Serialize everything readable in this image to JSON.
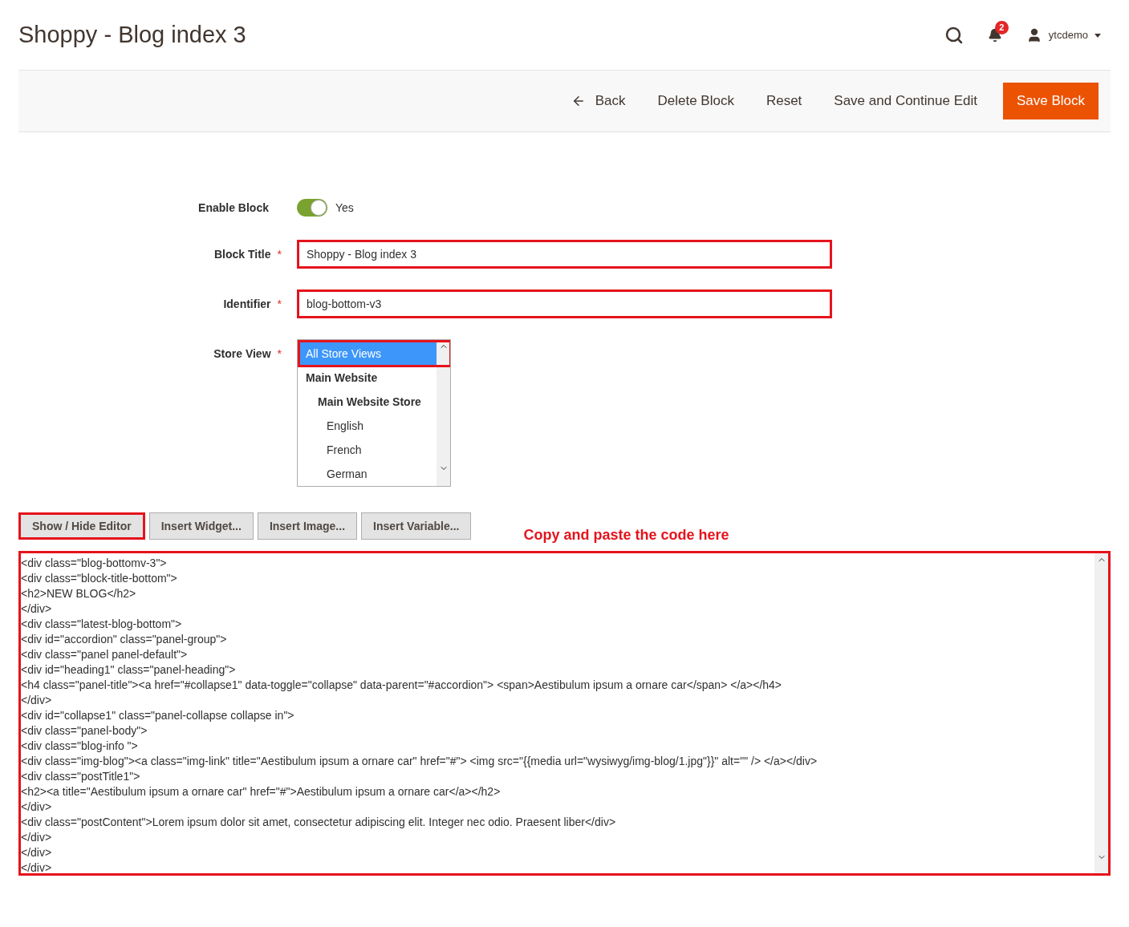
{
  "header": {
    "title": "Shoppy - Blog index 3",
    "notifications": "2",
    "user": "ytcdemo"
  },
  "actions": [
    {
      "label": "Back",
      "kind": "back"
    },
    {
      "label": "Delete Block",
      "kind": "plain"
    },
    {
      "label": "Reset",
      "kind": "plain"
    },
    {
      "label": "Save and Continue Edit",
      "kind": "plain"
    },
    {
      "label": "Save Block",
      "kind": "primary"
    }
  ],
  "form": {
    "enable": {
      "label": "Enable Block",
      "on": true,
      "value": "Yes"
    },
    "title": {
      "label": "Block Title",
      "required": "*",
      "value": "Shoppy - Blog index 3"
    },
    "identifier": {
      "label": "Identifier",
      "required": "*",
      "value": "blog-bottom-v3"
    },
    "store_view": {
      "label": "Store View",
      "required": "*",
      "options": [
        {
          "label": "All Store Views",
          "kind": "option",
          "selected": true
        },
        {
          "label": "Main Website",
          "kind": "group",
          "selected": false,
          "children": [
            {
              "label": "Main Website Store",
              "kind": "group",
              "selected": false,
              "children": [
                {
                  "label": "English",
                  "kind": "option",
                  "selected": false
                },
                {
                  "label": "French",
                  "kind": "option",
                  "selected": false
                },
                {
                  "label": "German",
                  "kind": "option",
                  "selected": false
                }
              ]
            }
          ]
        }
      ]
    }
  },
  "editor_buttons": [
    "Show / Hide Editor",
    "Insert Widget...",
    "Insert Image...",
    "Insert Variable..."
  ],
  "note": "Copy and paste the code here",
  "code_lines": [
    "<div class=\"blog-bottomv-3\">",
    "<div class=\"block-title-bottom\">",
    "<h2>NEW BLOG</h2>",
    "</div>",
    "<div class=\"latest-blog-bottom\">",
    "<div id=\"accordion\" class=\"panel-group\">",
    "<div class=\"panel panel-default\">",
    "<div id=\"heading1\" class=\"panel-heading\">",
    "<h4 class=\"panel-title\"><a href=\"#collapse1\" data-toggle=\"collapse\" data-parent=\"#accordion\"> <span>Aestibulum ipsum a ornare car</span> </a></h4>",
    "</div>",
    "<div id=\"collapse1\" class=\"panel-collapse collapse in\">",
    "<div class=\"panel-body\">",
    "<div class=\"blog-info \">",
    "<div class=\"img-blog\"><a class=\"img-link\" title=\"Aestibulum ipsum a ornare car\" href=\"#\"> <img src=\"{{media url=\"wysiwyg/img-blog/1.jpg\"}}\" alt=\"\" /> </a></div>",
    "<div class=\"postTitle1\">",
    "<h2><a title=\"Aestibulum ipsum a ornare car\" href=\"#\">Aestibulum ipsum a ornare car</a></h2>",
    "</div>",
    "<div class=\"postContent\">Lorem ipsum dolor sit amet, consectetur adipiscing elit. Integer nec odio. Praesent liber</div>",
    "</div>",
    "</div>",
    "</div>"
  ]
}
